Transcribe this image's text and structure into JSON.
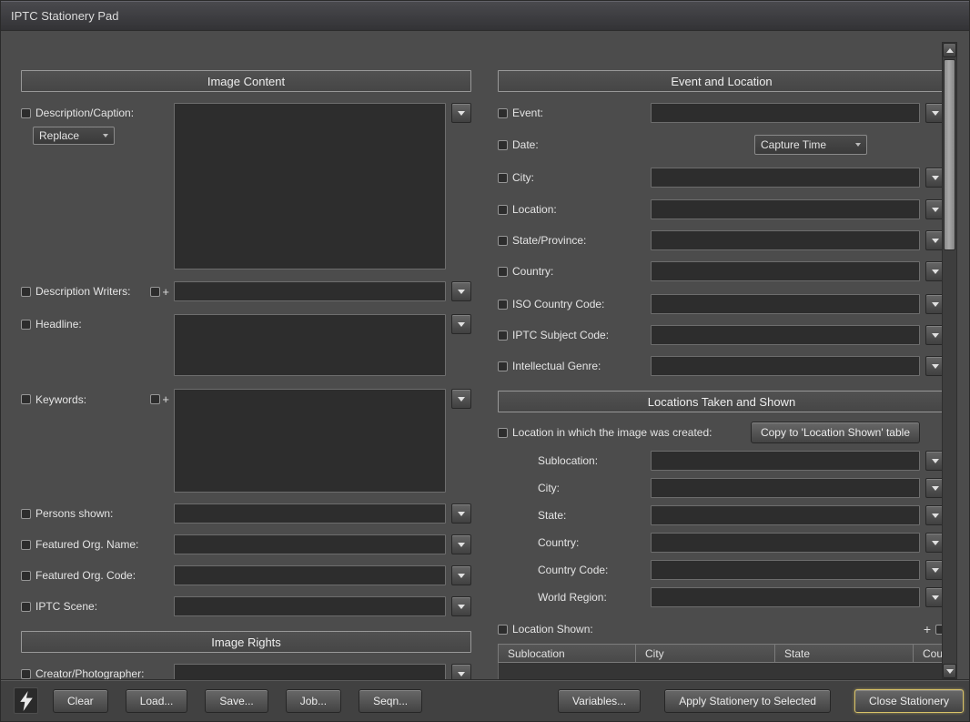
{
  "window": {
    "title": "IPTC Stationery Pad"
  },
  "image_content": {
    "header": "Image Content",
    "description": {
      "label": "Description/Caption:",
      "mode": "Replace"
    },
    "description_writers": {
      "label": "Description Writers:",
      "plus": "+"
    },
    "headline": {
      "label": "Headline:"
    },
    "keywords": {
      "label": "Keywords:",
      "plus": "+"
    },
    "persons_shown": {
      "label": "Persons shown:"
    },
    "featured_org_name": {
      "label": "Featured Org. Name:"
    },
    "featured_org_code": {
      "label": "Featured Org. Code:"
    },
    "iptc_scene": {
      "label": "IPTC Scene:"
    }
  },
  "image_rights": {
    "header": "Image Rights",
    "creator": {
      "label": "Creator/Photographer:"
    }
  },
  "event_location": {
    "header": "Event and Location",
    "event": {
      "label": "Event:"
    },
    "date": {
      "label": "Date:",
      "value": "Capture Time"
    },
    "city": {
      "label": "City:"
    },
    "location": {
      "label": "Location:"
    },
    "state_province": {
      "label": "State/Province:"
    },
    "country": {
      "label": "Country:"
    },
    "iso_country_code": {
      "label": "ISO Country Code:"
    },
    "iptc_subject_code": {
      "label": "IPTC Subject Code:"
    },
    "intellectual_genre": {
      "label": "Intellectual Genre:"
    }
  },
  "locations": {
    "header": "Locations Taken and Shown",
    "created": {
      "label": "Location in which the image was created:",
      "copy_button": "Copy to 'Location Shown' table"
    },
    "sub_fields": [
      {
        "label": "Sublocation:"
      },
      {
        "label": "City:"
      },
      {
        "label": "State:"
      },
      {
        "label": "Country:"
      },
      {
        "label": "Country Code:"
      },
      {
        "label": "World Region:"
      }
    ],
    "shown": {
      "label": "Location Shown:",
      "add": "+"
    },
    "table_headers": [
      "Sublocation",
      "City",
      "State",
      "Country"
    ]
  },
  "footer": {
    "clear": "Clear",
    "load": "Load...",
    "save": "Save...",
    "job": "Job...",
    "seqn": "Seqn...",
    "variables": "Variables...",
    "apply": "Apply Stationery to Selected",
    "close": "Close Stationery"
  }
}
